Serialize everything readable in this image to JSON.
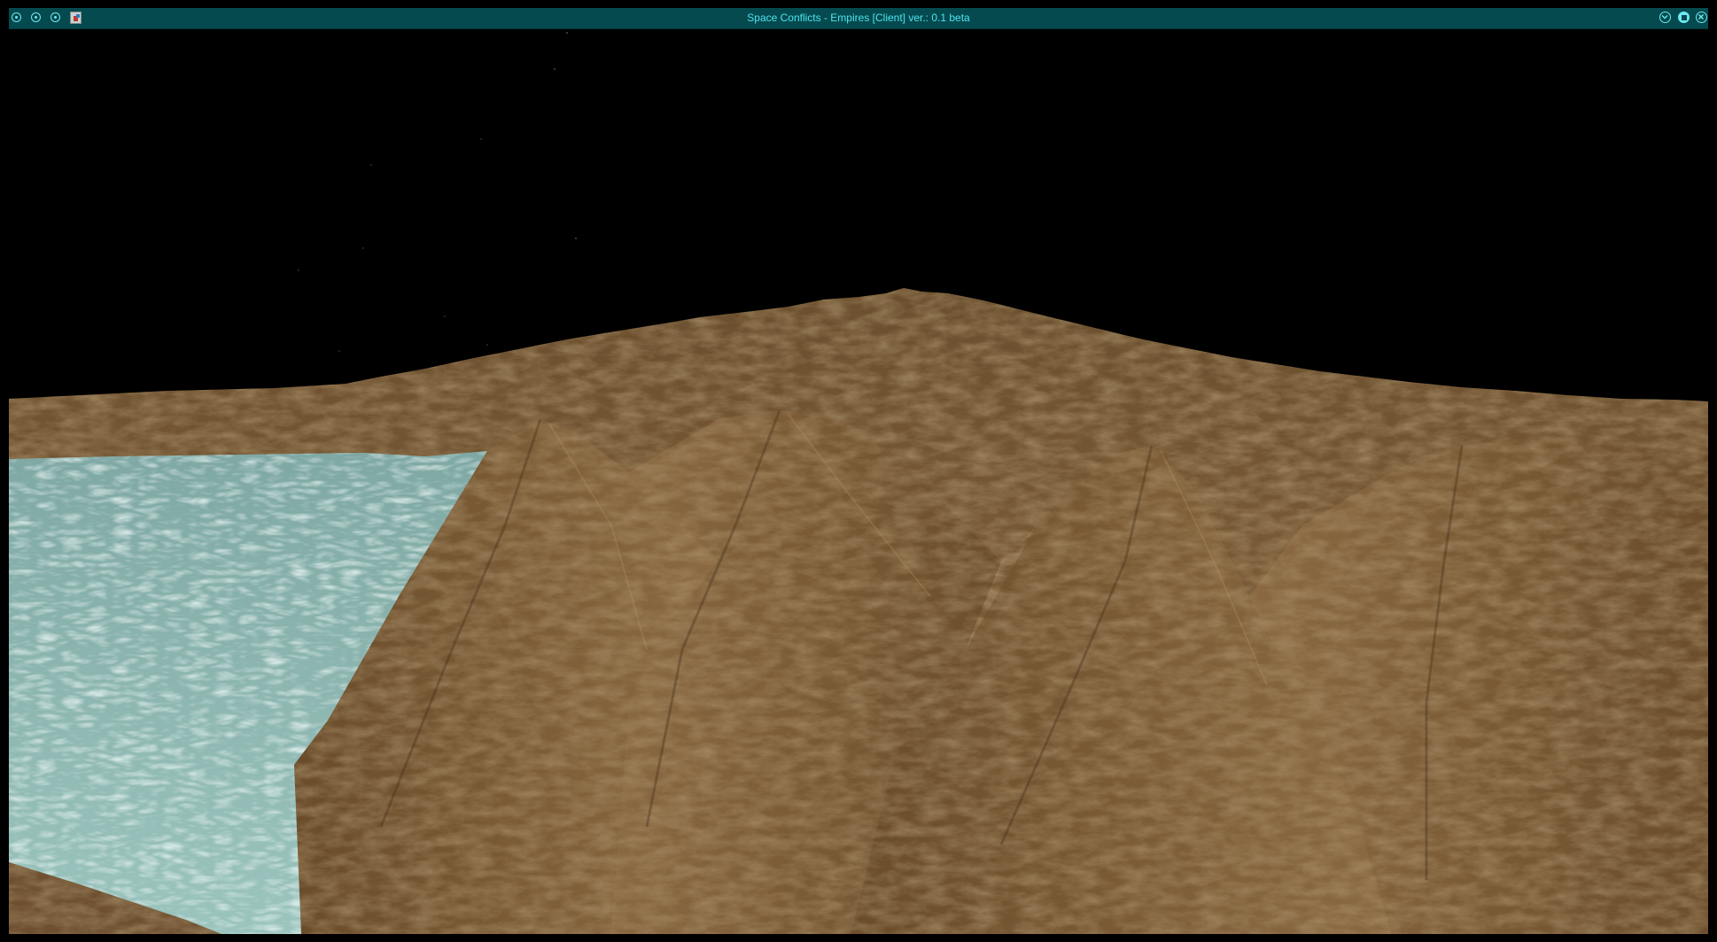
{
  "window": {
    "title": "Space Conflicts - Empires [Client] ver.: 0.1 beta",
    "title_color": "#4fe3ee",
    "titlebar_color": "#044a4f"
  },
  "titlebar_buttons": {
    "left": [
      "menu-icon",
      "pin-icon",
      "shade-icon"
    ],
    "app_icon": "java-app-icon",
    "right": [
      "minimize-icon",
      "maximize-icon",
      "close-icon"
    ]
  },
  "scene": {
    "sky_color": "#000000",
    "terrain_color": "#7a5a33",
    "water_color": "#8fb7b2"
  }
}
